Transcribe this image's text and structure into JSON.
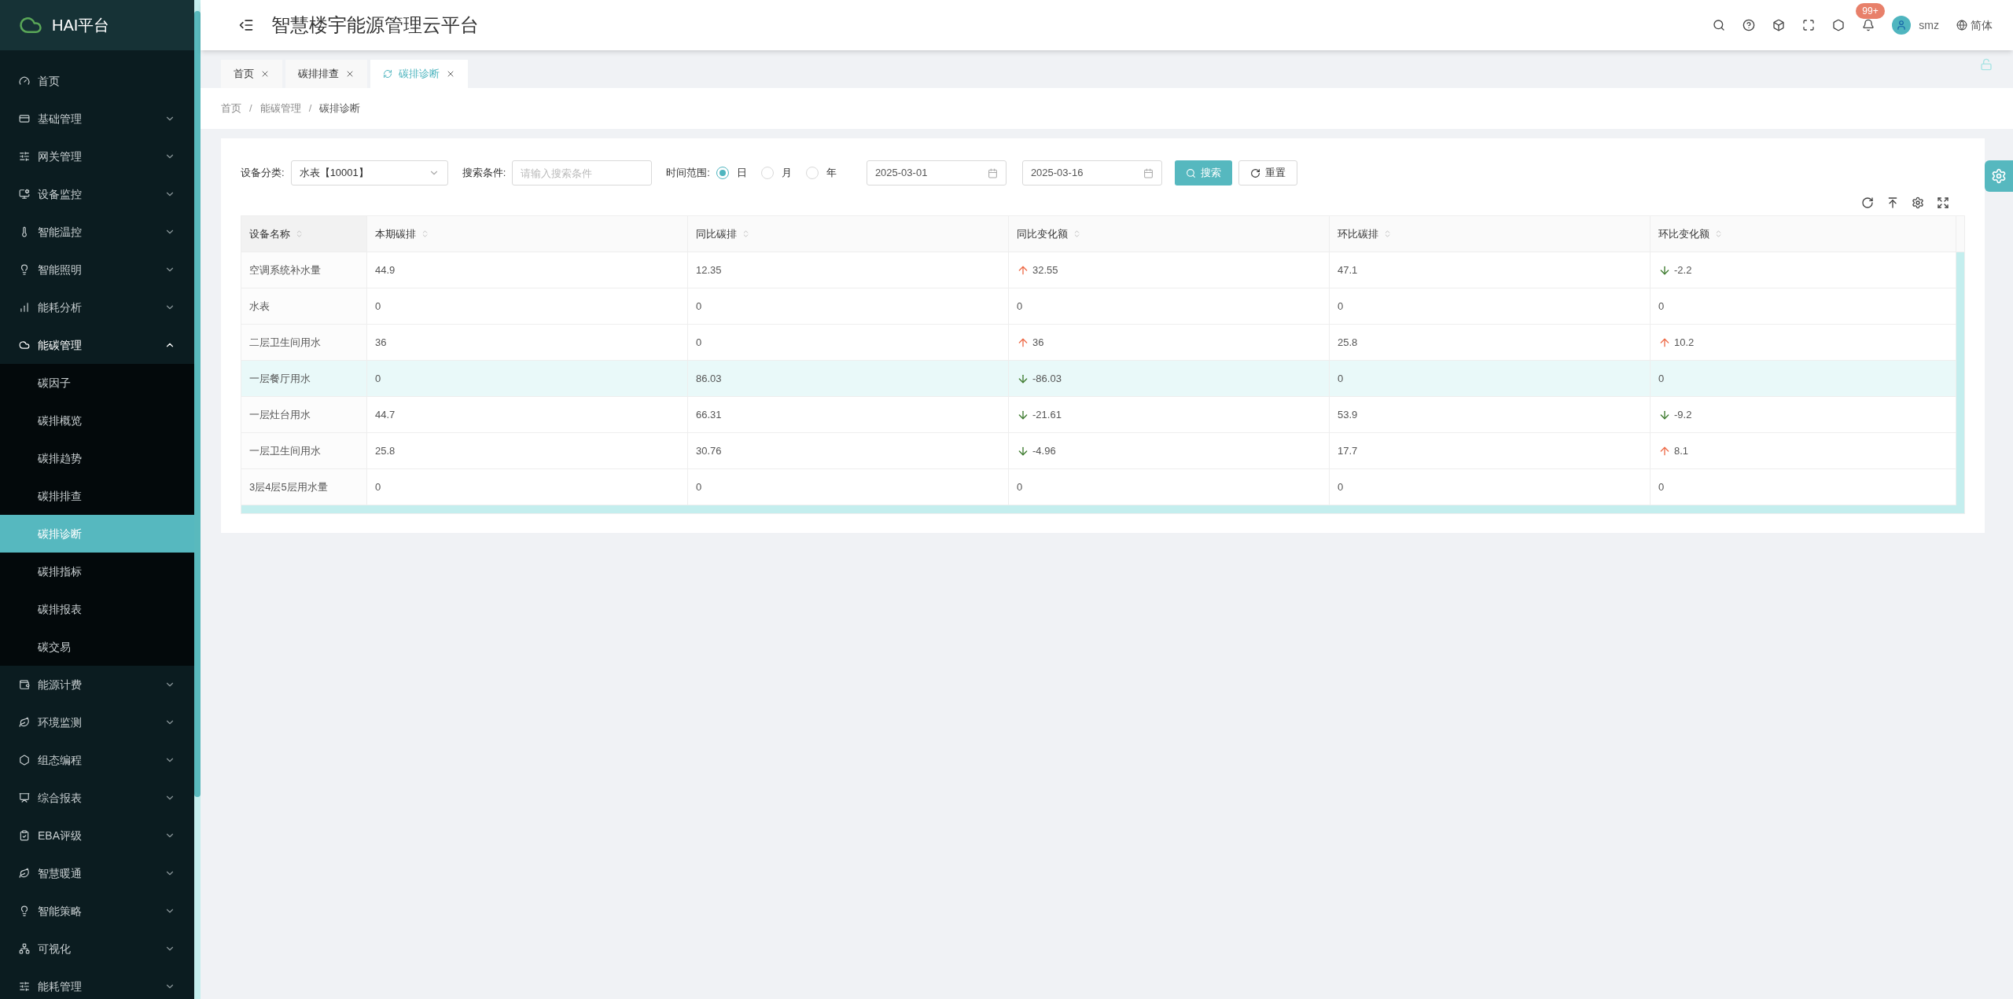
{
  "brand": {
    "title": "HAI平台"
  },
  "header": {
    "title": "智慧楼宇能源管理云平台",
    "notification_badge": "99+",
    "user": "smz",
    "language": "简体"
  },
  "sidebar": {
    "items": [
      {
        "label": "首页",
        "expandable": false,
        "expanded": false
      },
      {
        "label": "基础管理",
        "expandable": true,
        "expanded": false
      },
      {
        "label": "网关管理",
        "expandable": true,
        "expanded": false
      },
      {
        "label": "设备监控",
        "expandable": true,
        "expanded": false
      },
      {
        "label": "智能温控",
        "expandable": true,
        "expanded": false
      },
      {
        "label": "智能照明",
        "expandable": true,
        "expanded": false
      },
      {
        "label": "能耗分析",
        "expandable": true,
        "expanded": false
      },
      {
        "label": "能碳管理",
        "expandable": true,
        "expanded": true,
        "children": [
          {
            "label": "碳因子",
            "selected": false
          },
          {
            "label": "碳排概览",
            "selected": false
          },
          {
            "label": "碳排趋势",
            "selected": false
          },
          {
            "label": "碳排排查",
            "selected": false
          },
          {
            "label": "碳排诊断",
            "selected": true
          },
          {
            "label": "碳排指标",
            "selected": false
          },
          {
            "label": "碳排报表",
            "selected": false
          },
          {
            "label": "碳交易",
            "selected": false
          }
        ]
      },
      {
        "label": "能源计费",
        "expandable": true,
        "expanded": false
      },
      {
        "label": "环境监测",
        "expandable": true,
        "expanded": false
      },
      {
        "label": "组态编程",
        "expandable": true,
        "expanded": false
      },
      {
        "label": "综合报表",
        "expandable": true,
        "expanded": false
      },
      {
        "label": "EBA评级",
        "expandable": true,
        "expanded": false
      },
      {
        "label": "智慧暖通",
        "expandable": true,
        "expanded": false
      },
      {
        "label": "智能策略",
        "expandable": true,
        "expanded": false
      },
      {
        "label": "可视化",
        "expandable": true,
        "expanded": false
      },
      {
        "label": "能耗管理",
        "expandable": true,
        "expanded": false
      }
    ]
  },
  "tabs": [
    {
      "label": "首页",
      "selected": false
    },
    {
      "label": "碳排排查",
      "selected": false
    },
    {
      "label": "碳排诊断",
      "selected": true
    }
  ],
  "breadcrumb": [
    "首页",
    "能碳管理",
    "碳排诊断"
  ],
  "breadcrumb_separators": [
    "/",
    "/"
  ],
  "filters": {
    "category_label": "设备分类:",
    "category_value": "水表【10001】",
    "search_label": "搜索条件:",
    "search_placeholder": "请输入搜索条件",
    "range_label": "时间范围:",
    "range_options": [
      {
        "label": "日",
        "selected": true
      },
      {
        "label": "月",
        "selected": false
      },
      {
        "label": "年",
        "selected": false
      }
    ],
    "start_date": "2025-03-01",
    "end_date": "2025-03-16",
    "search_button": "搜索",
    "reset_button": "重置"
  },
  "table": {
    "columns": [
      "设备名称",
      "本期碳排",
      "同比碳排",
      "同比变化额",
      "环比碳排",
      "环比变化额"
    ],
    "rows": [
      {
        "selected": false,
        "cells": [
          "空调系统补水量",
          "44.9",
          "12.35",
          {
            "text": "32.55",
            "kind": "increase"
          },
          "47.1",
          {
            "text": "-2.2",
            "kind": "decrease"
          }
        ]
      },
      {
        "selected": false,
        "cells": [
          "水表",
          "0",
          "0",
          {
            "text": "0",
            "kind": "plain"
          },
          "0",
          {
            "text": "0",
            "kind": "plain"
          }
        ]
      },
      {
        "selected": false,
        "cells": [
          "二层卫生间用水",
          "36",
          "0",
          {
            "text": "36",
            "kind": "increase"
          },
          "25.8",
          {
            "text": "10.2",
            "kind": "increase"
          }
        ]
      },
      {
        "selected": true,
        "cells": [
          "一层餐厅用水",
          "0",
          "86.03",
          {
            "text": "-86.03",
            "kind": "decrease"
          },
          "0",
          {
            "text": "0",
            "kind": "plain"
          }
        ]
      },
      {
        "selected": false,
        "cells": [
          "一层灶台用水",
          "44.7",
          "66.31",
          {
            "text": "-21.61",
            "kind": "decrease"
          },
          "53.9",
          {
            "text": "-9.2",
            "kind": "decrease"
          }
        ]
      },
      {
        "selected": false,
        "cells": [
          "一层卫生间用水",
          "25.8",
          "30.76",
          {
            "text": "-4.96",
            "kind": "decrease"
          },
          "17.7",
          {
            "text": "8.1",
            "kind": "increase"
          }
        ]
      },
      {
        "selected": false,
        "cells": [
          "3层4层5层用水量",
          "0",
          "0",
          {
            "text": "0",
            "kind": "plain"
          },
          "0",
          {
            "text": "0",
            "kind": "plain"
          }
        ]
      }
    ]
  }
}
